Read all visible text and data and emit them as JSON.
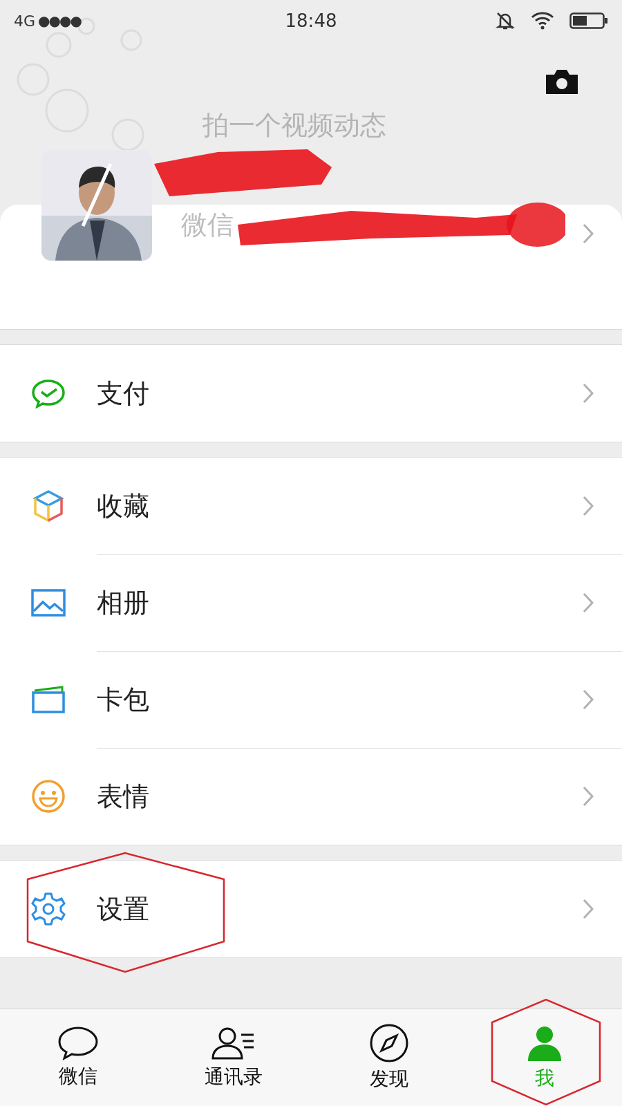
{
  "status_bar": {
    "network": "4G",
    "signal": "●●●●",
    "time": "18:48"
  },
  "profile": {
    "video_prompt": "拍一个视频动态",
    "id_label": "微信"
  },
  "groups": [
    {
      "items": [
        {
          "label": "支付",
          "kind": "pay"
        }
      ]
    },
    {
      "items": [
        {
          "label": "收藏",
          "kind": "favorites"
        },
        {
          "label": "相册",
          "kind": "album"
        },
        {
          "label": "卡包",
          "kind": "cards"
        },
        {
          "label": "表情",
          "kind": "stickers"
        }
      ]
    },
    {
      "items": [
        {
          "label": "设置",
          "kind": "settings"
        }
      ]
    }
  ],
  "tabs": [
    {
      "label": "微信",
      "kind": "chats",
      "selected": false
    },
    {
      "label": "通讯录",
      "kind": "contacts",
      "selected": false
    },
    {
      "label": "发现",
      "kind": "discover",
      "selected": false
    },
    {
      "label": "我",
      "kind": "me",
      "selected": true
    }
  ]
}
